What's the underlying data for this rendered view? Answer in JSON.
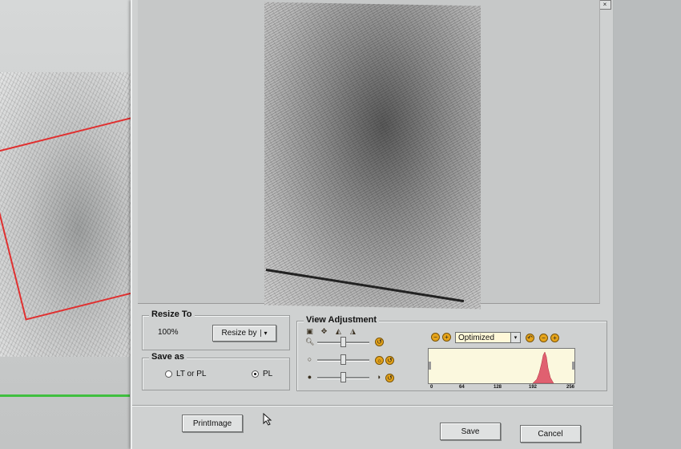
{
  "resize": {
    "legend": "Resize To",
    "percent": "100%",
    "button": "Resize by",
    "arrow": "▾"
  },
  "save_as": {
    "legend": "Save as",
    "options": [
      {
        "label": "LT or PL",
        "selected": false
      },
      {
        "label": "PL",
        "selected": true
      }
    ]
  },
  "view": {
    "legend": "View Adjustment",
    "mode_value": "Optimized",
    "mode_arrow": "▾"
  },
  "histogram": {
    "ticks": [
      "0",
      "64",
      "128",
      "192",
      "256"
    ],
    "fill_color": "#e06070",
    "bg_color": "#fbf8de"
  },
  "buttons": {
    "print": "PrintImage",
    "save": "Save",
    "cancel": "Cancel"
  },
  "window_controls": [
    "_",
    "□",
    "×"
  ],
  "colors": {
    "selection_border": "#e03030",
    "status_line": "#3fbf3f",
    "icon_orange": "#e6a41a"
  }
}
